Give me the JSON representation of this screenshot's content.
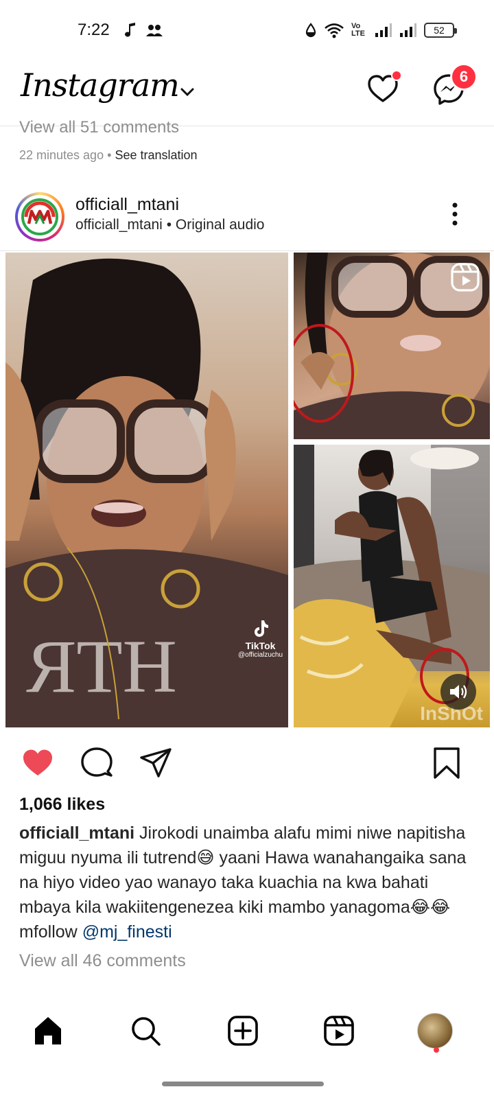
{
  "status_bar": {
    "time": "7:22",
    "network_label": "Vo LTE",
    "battery": "52"
  },
  "header": {
    "logo_text": "Instagram",
    "notifications_has_dot": true,
    "messages_badge": "6"
  },
  "previous_post": {
    "view_comments": "View all 51 comments",
    "time_ago": "22 minutes ago",
    "separator": "•",
    "see_translation": "See translation"
  },
  "post": {
    "username": "officiall_mtani",
    "audio_user": "officiall_mtani",
    "audio_separator": "•",
    "audio_label": "Original audio",
    "media_watermark": "TikTok",
    "media_handle": "@officialzuchu",
    "media_watermark_2": "InShOt",
    "likes": "1,066 likes",
    "liked": true,
    "caption_user": "officiall_mtani",
    "caption_text": "Jirokodi unaimba alafu mimi niwe napitisha miguu nyuma  ili tutrend😅 yaani Hawa wanahangaika sana na hiyo video yao wanayo taka kuachia na kwa bahati mbaya kila wakiitengenezea kiki mambo yanagoma😂😂 mfollow",
    "caption_mention": "@mj_finesti",
    "view_comments": "View all 46 comments"
  },
  "colors": {
    "like_red": "#ed4956",
    "badge_red": "#ff3040",
    "mention_blue": "#00376b",
    "muted_gray": "#8e8e8e"
  },
  "bottom_nav": {
    "items": [
      "home-icon",
      "search-icon",
      "create-icon",
      "reels-icon",
      "profile-avatar"
    ]
  }
}
